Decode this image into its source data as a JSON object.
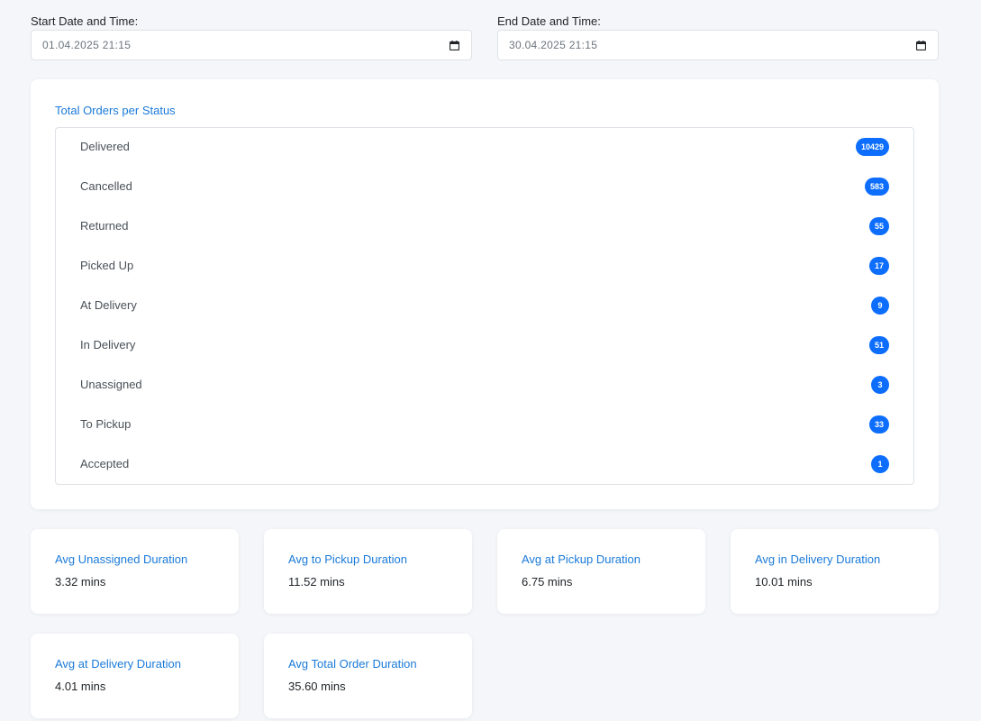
{
  "filters": {
    "start": {
      "label": "Start Date and Time:",
      "value": "01.04.2025 21:15"
    },
    "end": {
      "label": "End Date and Time:",
      "value": "30.04.2025 21:15"
    }
  },
  "status_card": {
    "title": "Total Orders per Status",
    "items": [
      {
        "label": "Delivered",
        "count": "10429"
      },
      {
        "label": "Cancelled",
        "count": "583"
      },
      {
        "label": "Returned",
        "count": "55"
      },
      {
        "label": "Picked Up",
        "count": "17"
      },
      {
        "label": "At Delivery",
        "count": "9"
      },
      {
        "label": "In Delivery",
        "count": "51"
      },
      {
        "label": "Unassigned",
        "count": "3"
      },
      {
        "label": "To Pickup",
        "count": "33"
      },
      {
        "label": "Accepted",
        "count": "1"
      }
    ]
  },
  "metrics": [
    {
      "title": "Avg Unassigned Duration",
      "value": "3.32 mins"
    },
    {
      "title": "Avg to Pickup Duration",
      "value": "11.52 mins"
    },
    {
      "title": "Avg at Pickup Duration",
      "value": "6.75 mins"
    },
    {
      "title": "Avg in Delivery Duration",
      "value": "10.01 mins"
    },
    {
      "title": "Avg at Delivery Duration",
      "value": "4.01 mins"
    },
    {
      "title": "Avg Total Order Duration",
      "value": "35.60 mins"
    }
  ],
  "colors": {
    "accent": "#1a7ad9",
    "badge": "#0d6efd",
    "background": "#f4f6fa"
  },
  "icons": {
    "date_picker": "calendar-icon"
  }
}
